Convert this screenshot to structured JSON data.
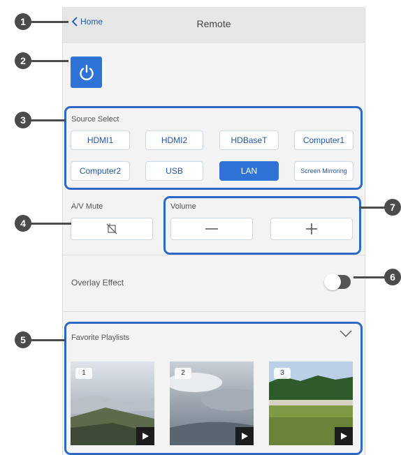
{
  "header": {
    "back_label": "Home",
    "title": "Remote"
  },
  "source_select": {
    "label": "Source Select",
    "buttons": [
      "HDMI1",
      "HDMI2",
      "HDBaseT",
      "Computer1",
      "Computer2",
      "USB",
      "LAN",
      "Screen Mirroring"
    ],
    "selected": "LAN"
  },
  "av_mute": {
    "label": "A/V Mute"
  },
  "volume": {
    "label": "Volume"
  },
  "overlay": {
    "label": "Overlay Effect",
    "enabled": false
  },
  "playlists": {
    "label": "Favorite Playlists",
    "items": [
      {
        "number": "1"
      },
      {
        "number": "2"
      },
      {
        "number": "3"
      }
    ]
  },
  "callouts": [
    "1",
    "2",
    "3",
    "4",
    "5",
    "6",
    "7"
  ],
  "colors": {
    "accent": "#2f73d6",
    "callout": "#4b4b4b",
    "highlight_border": "#2d68c6"
  }
}
